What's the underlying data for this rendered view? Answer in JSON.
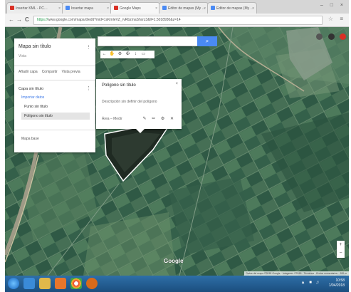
{
  "browser": {
    "tabs": [
      {
        "label": "Insertar KML - PC…",
        "color": "#d93025"
      },
      {
        "label": "Insertar mapa",
        "color": "#4a8af4"
      },
      {
        "label": "Google Maps",
        "color": "#d93025"
      },
      {
        "label": "Editor de mapas (My …",
        "color": "#4a8af4"
      },
      {
        "label": "Editor de mapas (My …",
        "color": "#4a8af4"
      }
    ],
    "tab_close": "×",
    "window_controls": "– □ ×",
    "nav_back": "←",
    "nav_forward": "→",
    "nav_reload": "C",
    "url_secure": "https://",
    "url_rest": "www.google.com/maps/d/edit?mid=1sKmleVZ_rvRbzmaShxrz3&ll=1.5018930&z=14",
    "star": "☆",
    "menu": "≡"
  },
  "map": {
    "search_button": "⌕",
    "tools": [
      "←",
      "✋",
      "⚙",
      "✠",
      "↕",
      "▭"
    ],
    "google_logo": "Google",
    "zoom": [
      "+",
      "−"
    ],
    "attribution": "Datos del mapa ©2018 Google · Imágenes ©2018 · Términos · Enviar comentarios · 200 m"
  },
  "panel": {
    "title": "Mapa sin título",
    "subtitle": "Vista",
    "more": "⋮",
    "actions": [
      "Añadir capa",
      "Compartir",
      "Vista previa"
    ],
    "layer_title": "Capa sin título",
    "layer_more": "⋮",
    "import_link": "Importar datos",
    "item1": "Punto sin título",
    "item2": "Polígono sin título",
    "base_map": "Mapa base"
  },
  "popup": {
    "title": "Polígono sin título",
    "close": "×",
    "description": "Descripción sin definir del polígono",
    "footer": "Área – Medir",
    "icons": "✎ ✏ ⚙ ✕"
  },
  "taskbar": {
    "tray_icons": "▲ ■ ♫",
    "time": "10:58",
    "date": "1/04/2018"
  },
  "colors": {
    "map_dark": "#2f5a43",
    "map_mid": "#4f7d5d",
    "map_light": "#6b9266",
    "search_blue": "#4a8af4",
    "taskbar": "#1b4e7e"
  }
}
